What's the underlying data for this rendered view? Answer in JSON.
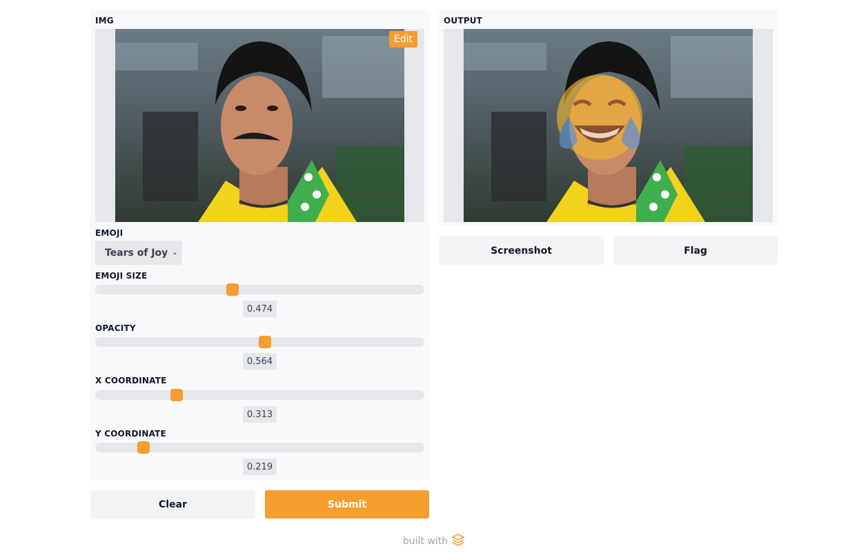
{
  "input": {
    "image_label": "IMG",
    "edit_label": "Edit",
    "emoji_label": "EMOJI",
    "emoji_selected": "Tears of Joy",
    "sliders": [
      {
        "label": "EMOJI SIZE",
        "value": "0.474",
        "fraction": 0.418
      },
      {
        "label": "OPACITY",
        "value": "0.564",
        "fraction": 0.515
      },
      {
        "label": "X COORDINATE",
        "value": "0.313",
        "fraction": 0.247
      },
      {
        "label": "Y COORDINATE",
        "value": "0.219",
        "fraction": 0.146
      }
    ]
  },
  "output": {
    "image_label": "OUTPUT",
    "screenshot_label": "Screenshot",
    "flag_label": "Flag"
  },
  "actions": {
    "clear_label": "Clear",
    "submit_label": "Submit"
  },
  "footer": {
    "text": "built with"
  },
  "colors": {
    "accent": "#f59e2f",
    "panel": "#f8f9fb",
    "track": "#e5e7eb"
  },
  "icons": [
    "chevron-down-icon",
    "gradio-logo-icon"
  ]
}
